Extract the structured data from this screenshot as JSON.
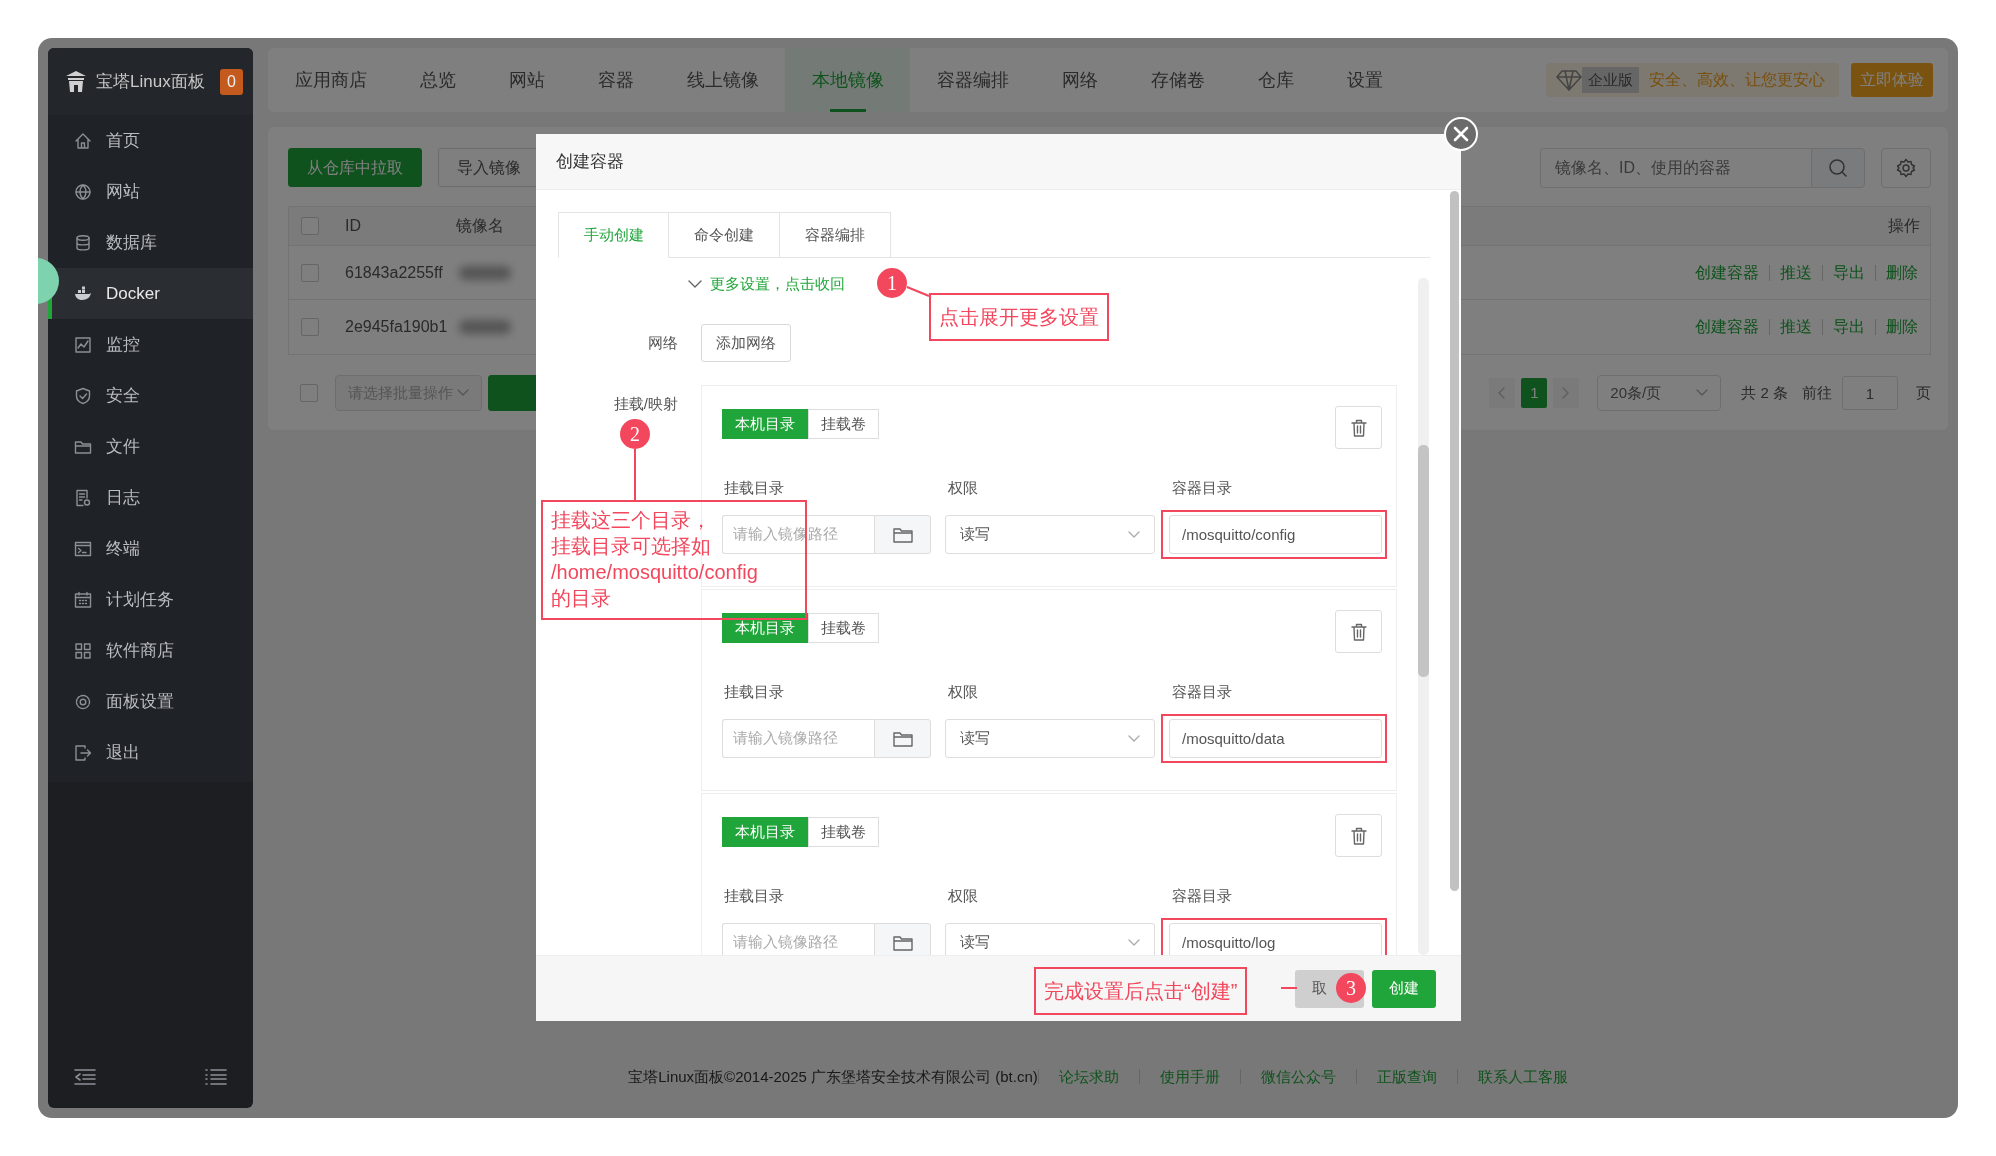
{
  "sidebar": {
    "logo": "宝塔Linux面板",
    "badge": "0",
    "items": [
      {
        "label": "首页",
        "selected": false
      },
      {
        "label": "网站",
        "selected": false
      },
      {
        "label": "数据库",
        "selected": false
      },
      {
        "label": "Docker",
        "selected": true
      },
      {
        "label": "监控",
        "selected": false
      },
      {
        "label": "安全",
        "selected": false
      },
      {
        "label": "文件",
        "selected": false
      },
      {
        "label": "日志",
        "selected": false
      },
      {
        "label": "终端",
        "selected": false
      },
      {
        "label": "计划任务",
        "selected": false
      },
      {
        "label": "软件商店",
        "selected": false
      },
      {
        "label": "面板设置",
        "selected": false
      },
      {
        "label": "退出",
        "selected": false
      }
    ]
  },
  "topnav": {
    "tabs": [
      {
        "label": "应用商店",
        "selected": false
      },
      {
        "label": "总览",
        "selected": false
      },
      {
        "label": "网站",
        "selected": false
      },
      {
        "label": "容器",
        "selected": false
      },
      {
        "label": "线上镜像",
        "selected": false
      },
      {
        "label": "本地镜像",
        "selected": true
      },
      {
        "label": "容器编排",
        "selected": false
      },
      {
        "label": "网络",
        "selected": false
      },
      {
        "label": "存储卷",
        "selected": false
      },
      {
        "label": "仓库",
        "selected": false
      },
      {
        "label": "设置",
        "selected": false
      }
    ],
    "edition": "企业版",
    "slogan": "安全、高效、让您更安心",
    "trial_button": "立即体验"
  },
  "toolbar": {
    "buttons": [
      {
        "label": "从仓库中拉取",
        "kind": "primary"
      },
      {
        "label": "导入镜像",
        "kind": "default"
      }
    ],
    "search": {
      "placeholder": "镜像名、ID、使用的容器"
    }
  },
  "table": {
    "columns": [
      "ID",
      "镜像名",
      "操作"
    ],
    "all_checked": false,
    "rows": [
      {
        "id": "61843a2255ff",
        "checked": false,
        "actions": [
          "创建容器",
          "推送",
          "导出",
          "删除"
        ]
      },
      {
        "id": "2e945fa190b1",
        "checked": false,
        "actions": [
          "创建容器",
          "推送",
          "导出",
          "删除"
        ]
      }
    ]
  },
  "pagination": {
    "batch_checked": false,
    "batch_placeholder": "请选择批量操作",
    "pages": [
      {
        "label": "1",
        "selected": true
      }
    ],
    "page_size": "20条/页",
    "total": "共 2 条",
    "goto_label": "前往",
    "goto_value": "1",
    "page_suffix": "页"
  },
  "footer": {
    "copyright": "宝塔Linux面板©2014-2025 广东堡塔安全技术有限公司 (bt.cn)",
    "links": [
      "论坛求助",
      "使用手册",
      "微信公众号",
      "正版查询",
      "联系人工客服"
    ]
  },
  "dialog": {
    "title": "创建容器",
    "tabs": [
      {
        "label": "手动创建",
        "selected": true
      },
      {
        "label": "命令创建",
        "selected": false
      },
      {
        "label": "容器编排",
        "selected": false
      }
    ],
    "toggle": "更多设置，点击收回",
    "network_label": "网络",
    "network_button": "添加网络",
    "mount_label": "挂载/映射",
    "mounts": [
      {
        "types": [
          {
            "label": "本机目录",
            "selected": true
          },
          {
            "label": "挂载卷",
            "selected": false
          }
        ],
        "host_label": "挂载目录",
        "host_placeholder": "请输入镜像路径",
        "perm_label": "权限",
        "perm_value": "读写",
        "container_label": "容器目录",
        "container_value": "/mosquitto/config",
        "highlighted": true
      },
      {
        "types": [
          {
            "label": "本机目录",
            "selected": true
          },
          {
            "label": "挂载卷",
            "selected": false
          }
        ],
        "host_label": "挂载目录",
        "host_placeholder": "请输入镜像路径",
        "perm_label": "权限",
        "perm_value": "读写",
        "container_label": "容器目录",
        "container_value": "/mosquitto/data",
        "highlighted": true
      },
      {
        "types": [
          {
            "label": "本机目录",
            "selected": true
          },
          {
            "label": "挂载卷",
            "selected": false
          }
        ],
        "host_label": "挂载目录",
        "host_placeholder": "请输入镜像路径",
        "perm_label": "权限",
        "perm_value": "读写",
        "container_label": "容器目录",
        "container_value": "/mosquitto/log",
        "highlighted": true
      }
    ],
    "buttons": [
      {
        "label": "取",
        "kind": "cancel"
      },
      {
        "label": "创建",
        "kind": "primary"
      }
    ]
  },
  "annotations": [
    {
      "number": "1",
      "lines": [
        "点击展开更多设置"
      ]
    },
    {
      "number": "2",
      "lines": [
        "挂载这三个目录，",
        "挂载目录可选择如",
        "/home/mosquitto/config",
        "的目录"
      ]
    },
    {
      "number": "3",
      "lines": [
        "完成设置后点击“创建”"
      ]
    }
  ]
}
